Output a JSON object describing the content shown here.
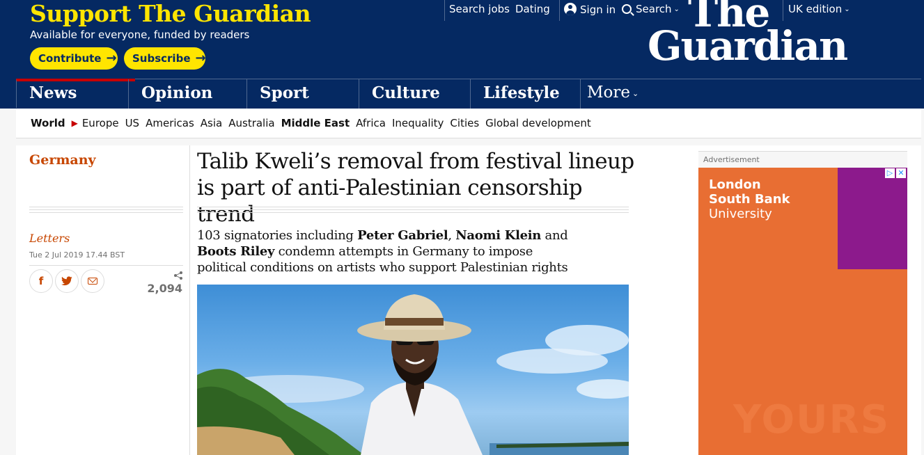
{
  "header": {
    "support_title": "Support The Guardian",
    "support_subtitle": "Available for everyone, funded by readers",
    "contribute_label": "Contribute",
    "subscribe_label": "Subscribe",
    "arrow_glyph": "→",
    "top_links": {
      "search_jobs": "Search jobs",
      "dating": "Dating",
      "sign_in": "Sign in",
      "search": "Search",
      "edition": "UK edition"
    },
    "chevron_glyph": "⌄",
    "logo_line1": "The",
    "logo_line2": "Guardian",
    "colors": {
      "brand_blue": "#052962",
      "highlight_yellow": "#ffe500",
      "news_red": "#c70000",
      "section_orange": "#c74600"
    }
  },
  "nav": {
    "pillars": [
      "News",
      "Opinion",
      "Sport",
      "Culture",
      "Lifestyle"
    ],
    "more_label": "More",
    "active_pillar": "News"
  },
  "subnav": {
    "world": "World",
    "arrow_glyph": "▶",
    "items": [
      "Europe",
      "US",
      "Americas",
      "Asia",
      "Australia",
      "Middle East",
      "Africa",
      "Inequality",
      "Cities",
      "Global development"
    ]
  },
  "article": {
    "section": "Germany",
    "series": "Letters",
    "dateline": "Tue 2 Jul 2019 17.44 BST",
    "share_count": "2,094",
    "share_count_icon": "share-icon",
    "headline": "Talib Kweli’s removal from festival lineup is part of anti-Palestinian censorship trend",
    "standfirst": {
      "part1": "103 signatories including ",
      "name1": "Peter Gabriel",
      "sep1": ", ",
      "name2": "Naomi Klein",
      "part2": " and ",
      "name3": "Boots Riley",
      "part3": " condemn attempts in Germany to impose political conditions on artists who support Palestinian rights"
    },
    "share_buttons": {
      "facebook": "f",
      "twitter": "twitter-icon",
      "email": "email-icon"
    },
    "image": "photo-of-man-in-fedora-and-sunglasses-on-beach"
  },
  "ad": {
    "label": "Advertisement",
    "line1": "London",
    "line2": "South Bank",
    "line3": "University",
    "watermark": "YOURS",
    "choices_glyph1": "▷",
    "choices_glyph2": "✕",
    "colors": {
      "background": "#e86e33",
      "accent": "#8c1a8c"
    }
  }
}
